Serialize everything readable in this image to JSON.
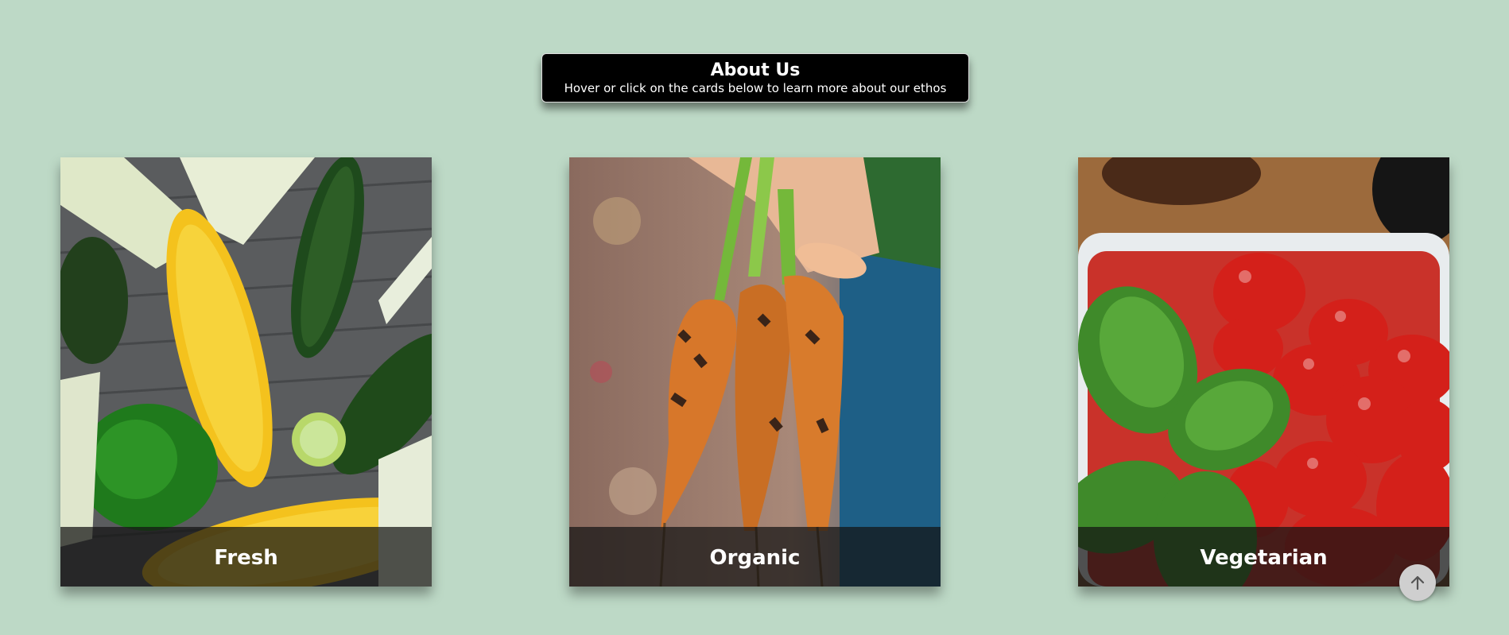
{
  "header": {
    "title": "About Us",
    "subtitle": "Hover or click on the cards below to learn more about our ethos"
  },
  "cards": [
    {
      "label": "Fresh",
      "image": "corn-cucumber-pepper-photo"
    },
    {
      "label": "Organic",
      "image": "hand-holding-carrots-photo"
    },
    {
      "label": "Vegetarian",
      "image": "tomatoes-basil-photo"
    }
  ],
  "scroll_top": {
    "icon": "arrow-up-icon"
  },
  "colors": {
    "background": "#bdd9c6",
    "header_bg": "#000000",
    "caption_bg": "#141414"
  }
}
